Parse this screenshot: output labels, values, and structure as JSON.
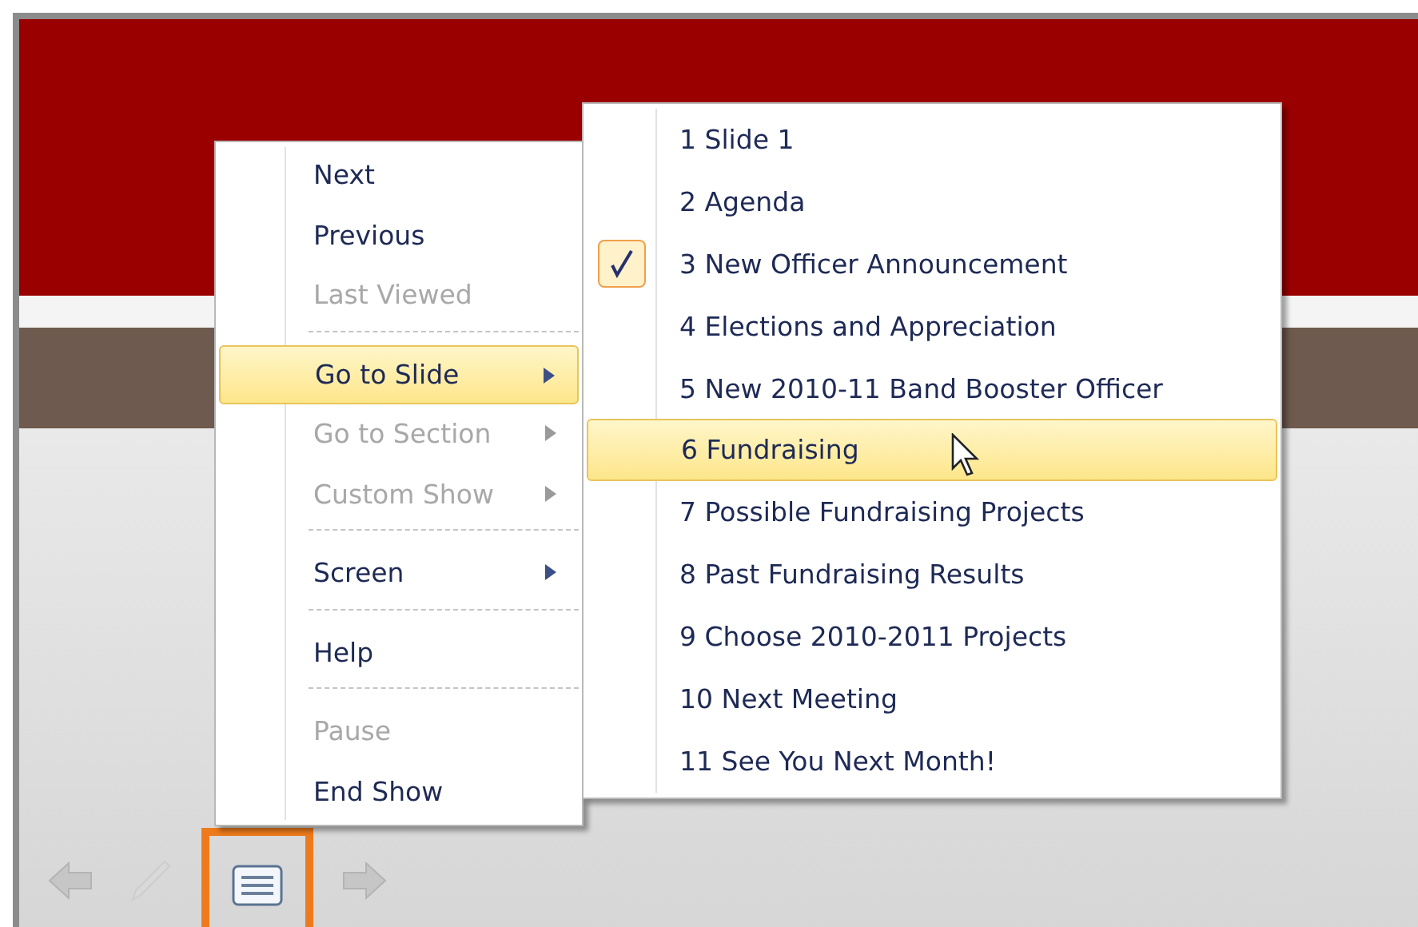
{
  "context_menu": {
    "items": [
      {
        "kind": "item",
        "label": "Next",
        "disabled": false,
        "submenu": false,
        "selected": false
      },
      {
        "kind": "item",
        "label": "Previous",
        "disabled": false,
        "submenu": false,
        "selected": false
      },
      {
        "kind": "item",
        "label": "Last Viewed",
        "disabled": true,
        "submenu": false,
        "selected": false
      },
      {
        "kind": "separator"
      },
      {
        "kind": "item",
        "label": "Go to Slide",
        "disabled": false,
        "submenu": true,
        "selected": true
      },
      {
        "kind": "item",
        "label": "Go to Section",
        "disabled": true,
        "submenu": true,
        "selected": false
      },
      {
        "kind": "item",
        "label": "Custom Show",
        "disabled": true,
        "submenu": true,
        "selected": false
      },
      {
        "kind": "separator"
      },
      {
        "kind": "item",
        "label": "Screen",
        "disabled": false,
        "submenu": true,
        "selected": false
      },
      {
        "kind": "separator"
      },
      {
        "kind": "item",
        "label": "Help",
        "disabled": false,
        "submenu": false,
        "selected": false
      },
      {
        "kind": "separator"
      },
      {
        "kind": "item",
        "label": "Pause",
        "disabled": true,
        "submenu": false,
        "selected": false
      },
      {
        "kind": "item",
        "label": "End Show",
        "disabled": false,
        "submenu": false,
        "selected": false
      }
    ]
  },
  "slide_submenu": {
    "items": [
      {
        "label": "1 Slide 1",
        "checked": false,
        "selected": false
      },
      {
        "label": "2 Agenda",
        "checked": false,
        "selected": false
      },
      {
        "label": "3 New Officer Announcement",
        "checked": true,
        "selected": false
      },
      {
        "label": "4 Elections and Appreciation",
        "checked": false,
        "selected": false
      },
      {
        "label": "5 New 2010-11 Band Booster Officer",
        "checked": false,
        "selected": false
      },
      {
        "label": "6 Fundraising",
        "checked": false,
        "selected": true
      },
      {
        "label": "7 Possible Fundraising Projects",
        "checked": false,
        "selected": false
      },
      {
        "label": "8 Past Fundraising Results",
        "checked": false,
        "selected": false
      },
      {
        "label": "9 Choose 2010-2011 Projects",
        "checked": false,
        "selected": false
      },
      {
        "label": "10 Next Meeting",
        "checked": false,
        "selected": false
      },
      {
        "label": "11 See You Next Month!",
        "checked": false,
        "selected": false
      }
    ]
  },
  "toolbar": {
    "buttons": [
      {
        "kind": "previous",
        "selected": false
      },
      {
        "kind": "pen",
        "selected": false
      },
      {
        "kind": "menu",
        "selected": true
      },
      {
        "kind": "next",
        "selected": false
      }
    ]
  }
}
